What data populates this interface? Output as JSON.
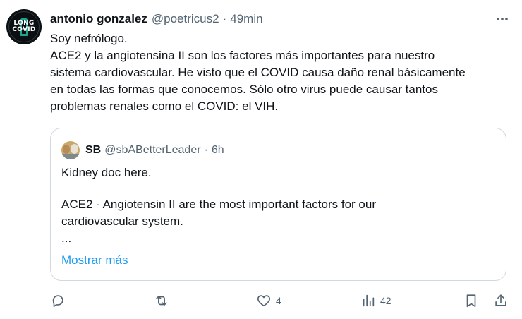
{
  "author": {
    "name": "antonio gonzalez",
    "handle": "@poetricus2",
    "separator": "·",
    "time": "49min",
    "avatar_text": [
      "LONG",
      "COVID"
    ]
  },
  "tweet": {
    "lines": [
      "Soy nefrólogo.",
      "ACE2 y la angiotensina II son los factores más importantes para nuestro",
      "sistema cardiovascular. He visto que el COVID causa daño renal básicamente",
      "en todas las formas que conocemos. Sólo otro virus puede causar tantos",
      "problemas renales como el COVID: el VIH."
    ]
  },
  "quoted": {
    "name": "SB",
    "handle": "@sbABetterLeader",
    "separator": "·",
    "time": "6h",
    "line1": "Kidney doc here.",
    "line2": "ACE2 - Angiotensin II are the most important factors for our",
    "line3": "cardiovascular system.",
    "ellipsis": "...",
    "show_more": "Mostrar más"
  },
  "actions": {
    "reply_icon": "reply-icon",
    "retweet_icon": "retweet-icon",
    "like_icon": "heart-icon",
    "like_count": "4",
    "views_icon": "views-icon",
    "views_count": "42",
    "bookmark_icon": "bookmark-icon",
    "share_icon": "share-icon"
  },
  "colors": {
    "text": "#0f1419",
    "secondary": "#536471",
    "link": "#1d9bf0",
    "border": "#cfd9de"
  }
}
